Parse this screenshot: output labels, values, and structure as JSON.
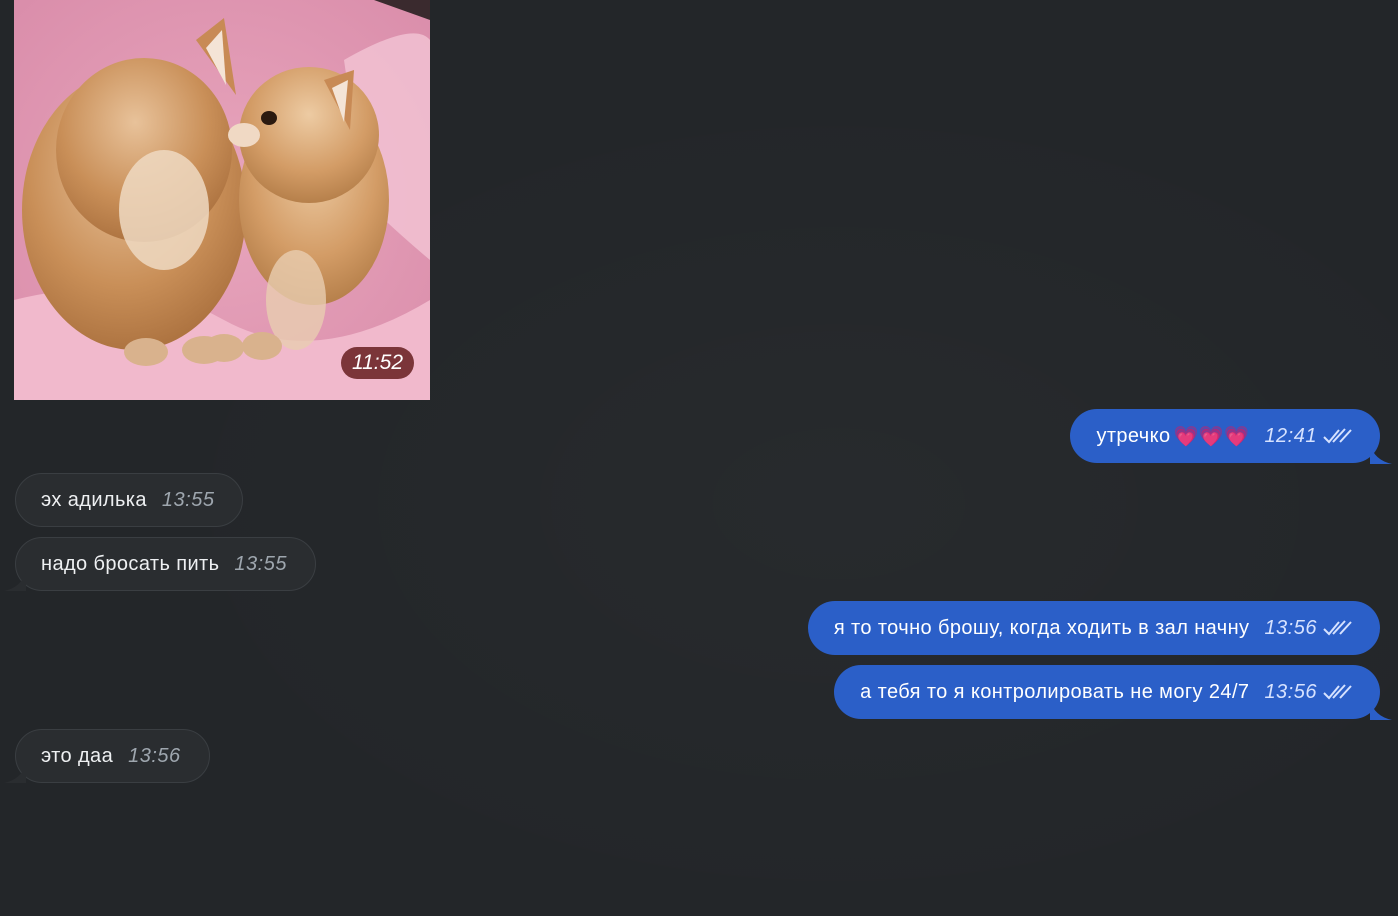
{
  "photo_message": {
    "time": "11:52"
  },
  "messages": [
    {
      "direction": "outgoing",
      "text": "утречко",
      "emoji": "💗💗💗",
      "time": "12:41",
      "status_icon": "double-check-icon"
    },
    {
      "direction": "incoming",
      "text": "эх адилька",
      "time": "13:55"
    },
    {
      "direction": "incoming",
      "text": "надо бросать пить",
      "time": "13:55"
    },
    {
      "direction": "outgoing",
      "text": "я то точно брошу, когда ходить в зал начну",
      "time": "13:56",
      "status_icon": "double-check-icon"
    },
    {
      "direction": "outgoing",
      "text": "а тебя то я контролировать не могу 24/7",
      "time": "13:56",
      "status_icon": "double-check-icon"
    },
    {
      "direction": "incoming",
      "text": "это даа",
      "time": "13:56"
    }
  ],
  "colors": {
    "background": "#232629",
    "outgoing_bubble": "#2b5fc8",
    "incoming_bubble": "#2a2d30"
  }
}
